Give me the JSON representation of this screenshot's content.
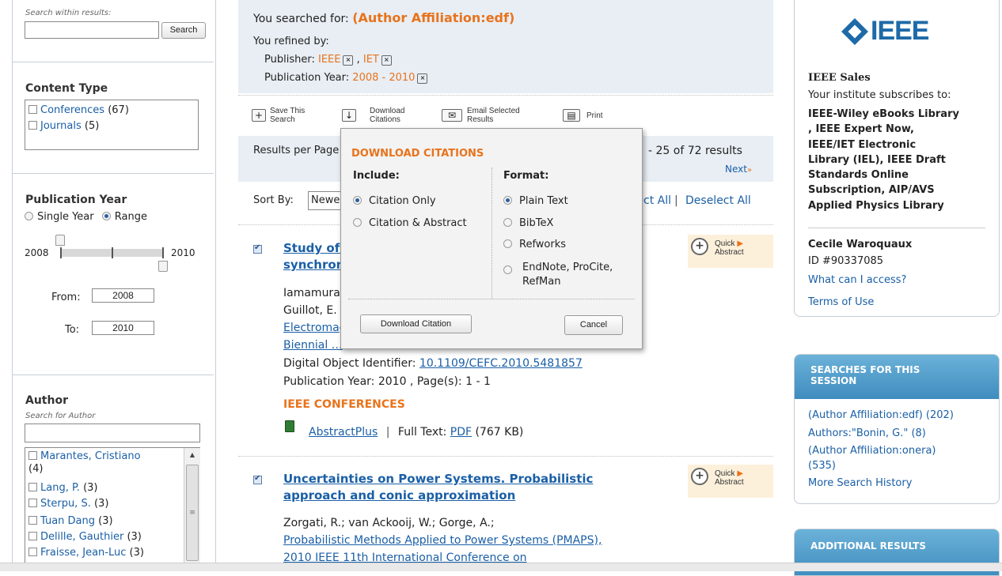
{
  "left": {
    "search_within": {
      "placeholder": "Search within results:",
      "button": "Search"
    },
    "content_type": {
      "title": "Content Type",
      "items": [
        {
          "label": "Conferences",
          "count": "(67)"
        },
        {
          "label": "Journals",
          "count": "(5)"
        }
      ]
    },
    "publication_year": {
      "title": "Publication Year",
      "single_year": "Single Year",
      "range": "Range",
      "min": "2008",
      "max": "2010",
      "from_label": "From:",
      "from_value": "2008",
      "to_label": "To:",
      "to_value": "2010"
    },
    "author": {
      "title": "Author",
      "search_placeholder": "Search for Author",
      "items": [
        {
          "name": "Marantes, Cristiano",
          "count": "(4)"
        },
        {
          "name": "Lang, P.",
          "count": "(3)"
        },
        {
          "name": "Sterpu, S.",
          "count": "(3)"
        },
        {
          "name": "Tuan Dang",
          "count": "(3)"
        },
        {
          "name": "Delille, Gauthier",
          "count": "(3)"
        },
        {
          "name": "Fraisse, Jean-Luc",
          "count": "(3)"
        }
      ]
    }
  },
  "search_summary": {
    "searched_for_label": "You searched for:",
    "searched_for_value": "(Author Affiliation:edf)",
    "refined_by_label": "You refined by:",
    "publisher_label": "Publisher:",
    "publishers": [
      "IEEE",
      "IET"
    ],
    "pub_year_label": "Publication Year:",
    "pub_year_value": "2008 - 2010"
  },
  "toolbar": {
    "save_line1": "Save This",
    "save_line2": "Search",
    "download_line1": "Download",
    "download_line2": "Citations",
    "email_line1": "Email Selected",
    "email_line2": "Results",
    "print": "Print"
  },
  "results_bar": {
    "per_page": "Results per Page",
    "count_text": "- 25 of 72 results",
    "next": "Next"
  },
  "sort": {
    "label": "Sort By:",
    "value": "Newest First",
    "select_all": "Select All",
    "deselect_all": "Deselect All"
  },
  "download_popup": {
    "title": "DOWNLOAD CITATIONS",
    "include_label": "Include:",
    "include_options": [
      "Citation Only",
      "Citation & Abstract"
    ],
    "format_label": "Format:",
    "format_options": [
      "Plain Text",
      "BibTeX",
      "Refworks",
      "EndNote, ProCite, RefMan"
    ],
    "download_button": "Download Citation",
    "cancel_button": "Cancel"
  },
  "results": [
    {
      "title_line1": "Study of … of a",
      "title_line2": "synchronous …",
      "authors_line1": "Iamamura, … ;",
      "authors_line2": "Guillot, E.",
      "venue_line1": "Electromagnetic …",
      "venue_line2": "Biennial …",
      "doi_label": "Digital Object Identifier:",
      "doi": "10.1109/CEFC.2010.5481857",
      "pub_info": "Publication Year: 2010 , Page(s): 1 - 1",
      "type": "IEEE CONFERENCES",
      "abstract_plus": "AbstractPlus",
      "full_text_label": "Full Text:",
      "pdf": "PDF",
      "size": "(767 KB)",
      "quick_line1": "Quick",
      "quick_line2": "Abstract"
    },
    {
      "title_line1": "Uncertainties on Power Systems. Probabilistic",
      "title_line2": "approach and conic approximation",
      "authors": "Zorgati, R.; van Ackooij, W.; Gorge, A.;",
      "venue_line1": "Probabilistic Methods Applied to Power Systems (PMAPS),",
      "venue_line2": "2010 IEEE 11th International Conference on",
      "quick_line1": "Quick",
      "quick_line2": "Abstract"
    }
  ],
  "right": {
    "logo_text": "IEEE",
    "sales_title": "IEEE Sales",
    "subscribes_text": "Your institute subscribes to:",
    "subscriptions": [
      "IEEE-Wiley eBooks Library",
      ", IEEE Expert Now,",
      "IEEE/IET Electronic",
      "Library (IEL), IEEE Draft",
      "Standards Online",
      "Subscription, AIP/AVS",
      "Applied Physics Library"
    ],
    "user_name": "Cecile Waroquaux",
    "user_id": "ID #90337085",
    "what_access": "What can I access?",
    "terms": "Terms of Use",
    "session_header_line1": "SEARCHES FOR THIS",
    "session_header_line2": "SESSION",
    "session_items": [
      "(Author Affiliation:edf) (202)",
      "Authors:\"Bonin, G.\" (8)",
      "(Author Affiliation:onera)",
      "(535)",
      "More Search History"
    ],
    "additional_header": "ADDITIONAL RESULTS"
  }
}
